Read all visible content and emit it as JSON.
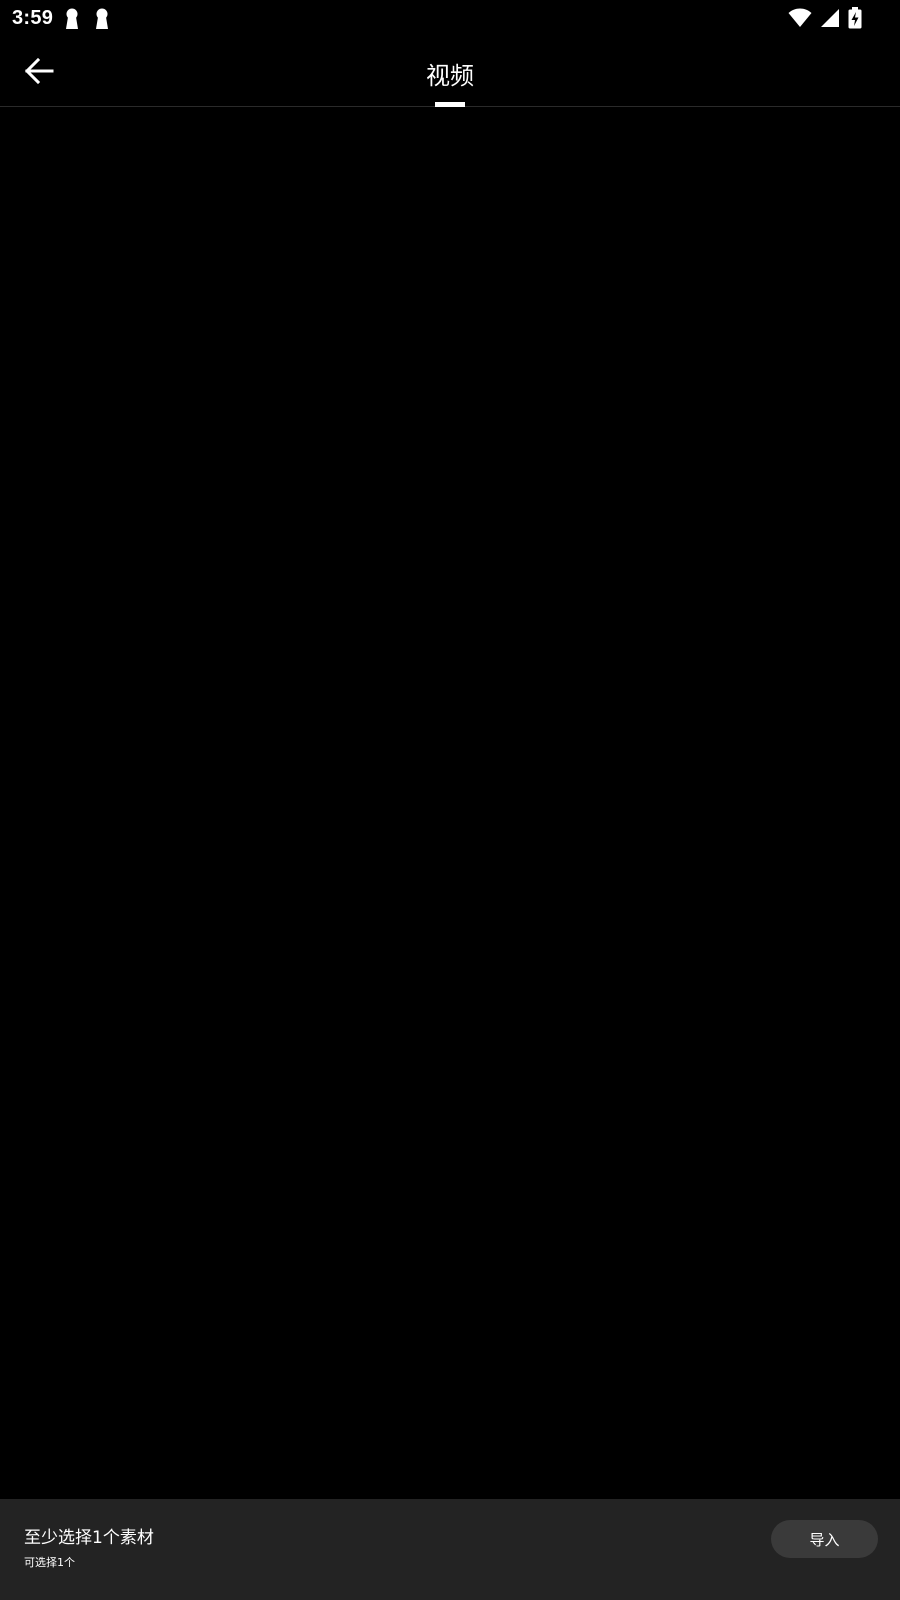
{
  "status_bar": {
    "time": "3:59",
    "left_icons": [
      "keyhole-notification-icon",
      "keyhole-notification-icon"
    ],
    "right_icons": [
      "wifi-icon",
      "cellular-signal-icon",
      "battery-charging-icon"
    ]
  },
  "app_bar": {
    "back_icon": "arrow-left-icon",
    "tabs": [
      {
        "label": "视频",
        "selected": true
      }
    ]
  },
  "bottom_panel": {
    "title": "至少选择1个素材",
    "subtitle": "可选择1个",
    "import_label": "导入"
  },
  "colors": {
    "background": "#000000",
    "bottom_panel": "#232323",
    "button": "#3a3a3a",
    "text": "#ffffff"
  }
}
